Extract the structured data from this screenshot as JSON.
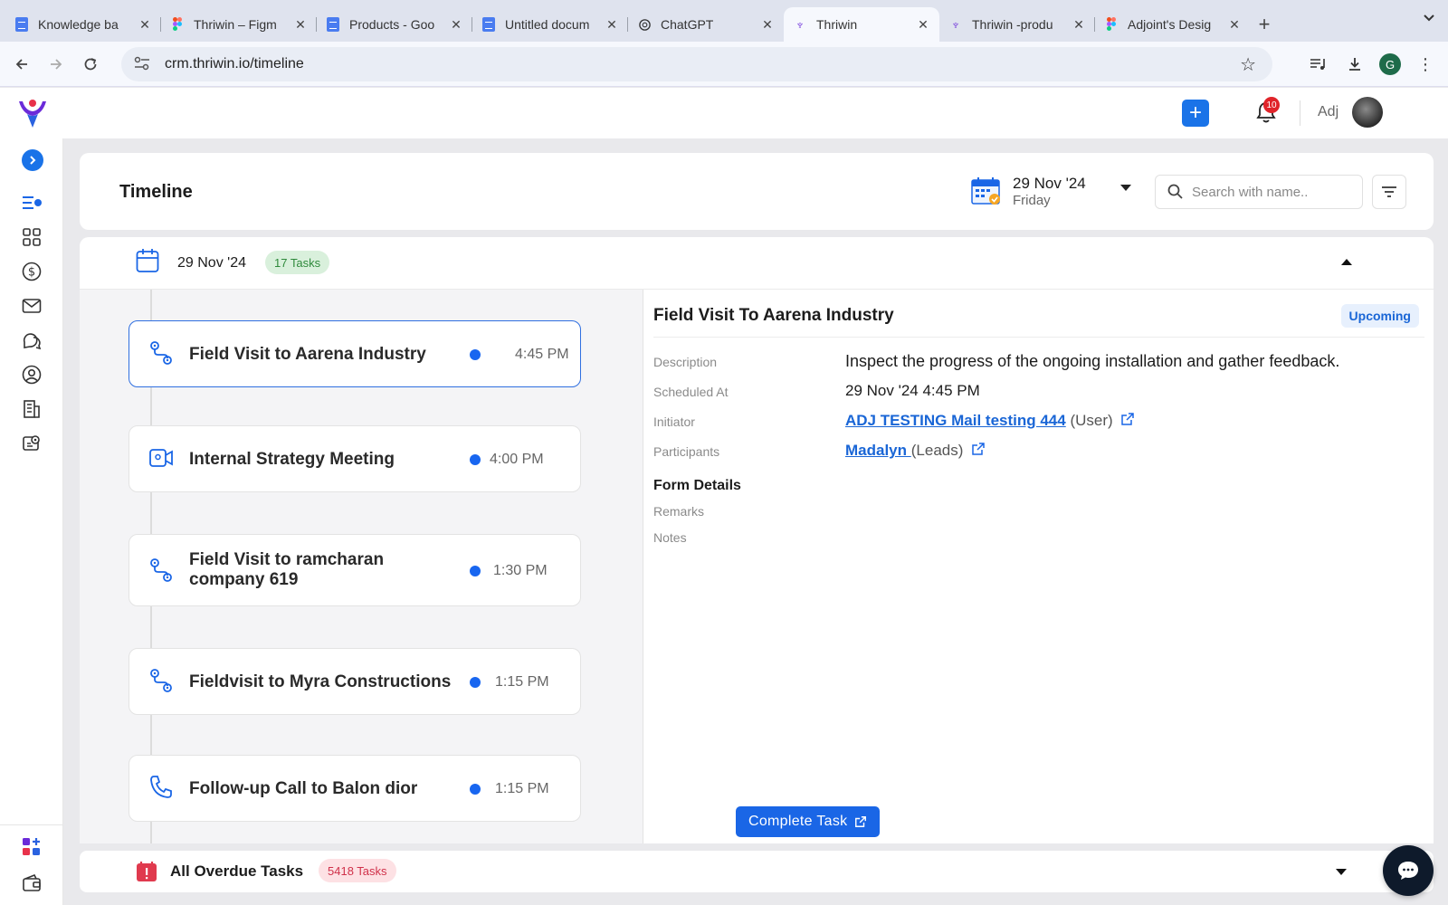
{
  "browser": {
    "tabs": [
      {
        "title": "Knowledge ba",
        "icon": "google-docs-icon",
        "active": false
      },
      {
        "title": "Thriwin – Figm",
        "icon": "figma-icon",
        "active": false
      },
      {
        "title": "Products - Goo",
        "icon": "google-docs-icon",
        "active": false
      },
      {
        "title": "Untitled docum",
        "icon": "google-docs-icon",
        "active": false
      },
      {
        "title": "ChatGPT",
        "icon": "chatgpt-icon",
        "active": false
      },
      {
        "title": "Thriwin",
        "icon": "thriwin-icon",
        "active": true
      },
      {
        "title": "Thriwin -produ",
        "icon": "thriwin-icon",
        "active": false
      },
      {
        "title": "Adjoint's Desig",
        "icon": "figma-icon",
        "active": false
      }
    ],
    "url": "crm.thriwin.io/timeline",
    "profile_initial": "G"
  },
  "header": {
    "notification_count": "10",
    "user_name": "Adj",
    "accent": "#1a73e8"
  },
  "page": {
    "title": "Timeline",
    "date_picker": {
      "date": "29 Nov '24",
      "weekday": "Friday"
    },
    "search_placeholder": "Search with name.."
  },
  "timeline": {
    "date": "29 Nov '24",
    "task_count_label": "17 Tasks",
    "tasks": [
      {
        "name": "Field Visit to Aarena Industry",
        "time": "4:45 PM",
        "icon": "field-visit-icon",
        "selected": true
      },
      {
        "name": "Internal Strategy Meeting",
        "time": "4:00 PM",
        "icon": "video-meeting-icon",
        "selected": false
      },
      {
        "name": "Field Visit to ramcharan company 619",
        "time": "1:30 PM",
        "icon": "field-visit-icon",
        "selected": false
      },
      {
        "name": "Fieldvisit to Myra Constructions",
        "time": "1:15 PM",
        "icon": "field-visit-icon",
        "selected": false
      },
      {
        "name": "Follow-up Call to Balon dior",
        "time": "1:15 PM",
        "icon": "phone-icon",
        "selected": false
      }
    ]
  },
  "detail": {
    "title": "Field Visit To Aarena Industry",
    "status": "Upcoming",
    "labels": {
      "description": "Description",
      "scheduled_at": "Scheduled At",
      "initiator": "Initiator",
      "participants": "Participants",
      "form_details": "Form Details",
      "remarks": "Remarks",
      "notes": "Notes"
    },
    "description": "Inspect the progress of the ongoing installation and gather feedback.",
    "scheduled_at": "29 Nov '24 4:45 PM",
    "initiator_name": "ADJ TESTING Mail testing 444",
    "initiator_tag": "(User)",
    "participant_name": "Madalyn ",
    "participant_tag": "(Leads)",
    "complete_label": "Complete Task"
  },
  "overdue": {
    "title": "All Overdue Tasks",
    "count_label": "5418 Tasks"
  }
}
